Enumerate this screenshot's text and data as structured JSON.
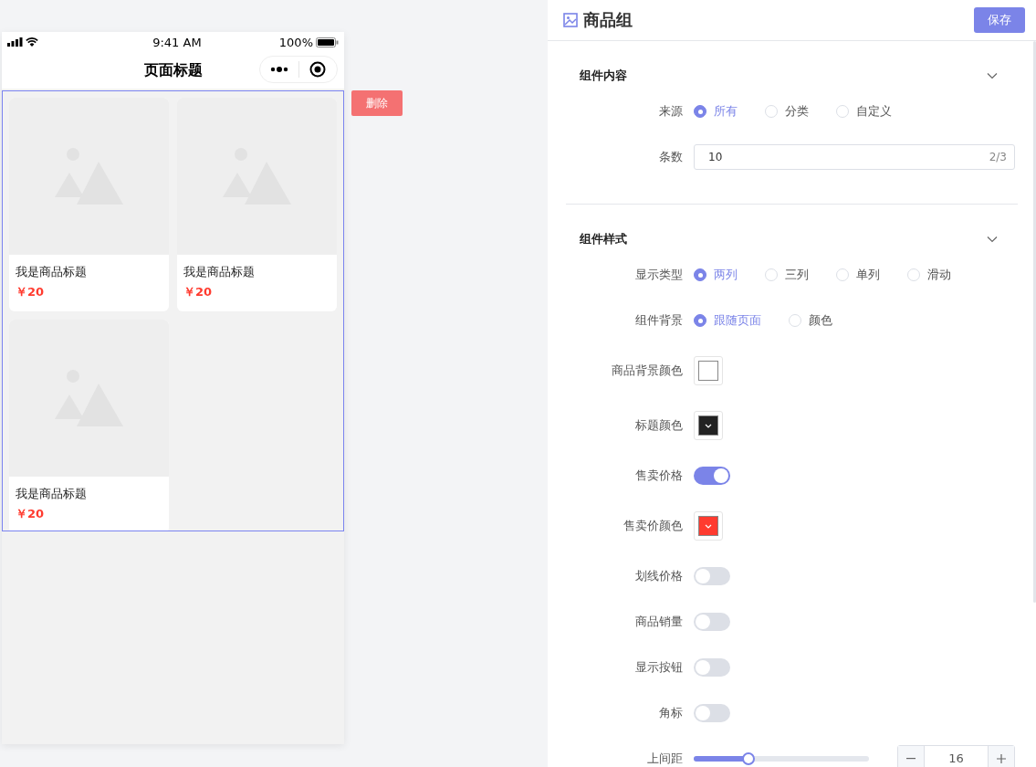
{
  "phone": {
    "status_bar": {
      "time": "9:41 AM",
      "battery": "100%"
    },
    "title": "页面标题",
    "products": [
      {
        "title": "我是商品标题",
        "price": "￥20"
      },
      {
        "title": "我是商品标题",
        "price": "￥20"
      },
      {
        "title": "我是商品标题",
        "price": "￥20"
      }
    ],
    "delete_button": "删除"
  },
  "panel": {
    "title": "商品组",
    "save_button": "保存",
    "sections": [
      {
        "title": "组件内容",
        "expanded": true,
        "fields": [
          {
            "kind": "radio",
            "label": "来源",
            "options": [
              {
                "label": "所有",
                "selected": true
              },
              {
                "label": "分类",
                "selected": false
              },
              {
                "label": "自定义",
                "selected": false
              }
            ]
          },
          {
            "kind": "input",
            "label": "条数",
            "value": "10",
            "counter": "2/3"
          }
        ]
      },
      {
        "title": "组件样式",
        "expanded": true,
        "fields": [
          {
            "kind": "radio",
            "label": "显示类型",
            "options": [
              {
                "label": "两列",
                "selected": true
              },
              {
                "label": "三列",
                "selected": false
              },
              {
                "label": "单列",
                "selected": false
              },
              {
                "label": "滑动",
                "selected": false
              }
            ]
          },
          {
            "kind": "radio",
            "label": "组件背景",
            "options": [
              {
                "label": "跟随页面",
                "selected": true
              },
              {
                "label": "颜色",
                "selected": false
              }
            ]
          },
          {
            "kind": "color",
            "label": "商品背景颜色",
            "color": "#ffffff"
          },
          {
            "kind": "color",
            "label": "标题颜色",
            "color": "#222222"
          },
          {
            "kind": "switch",
            "label": "售卖价格",
            "on": true
          },
          {
            "kind": "color",
            "label": "售卖价颜色",
            "color": "#ff3b2f"
          },
          {
            "kind": "switch",
            "label": "划线价格",
            "on": false
          },
          {
            "kind": "switch",
            "label": "商品销量",
            "on": false
          },
          {
            "kind": "switch",
            "label": "显示按钮",
            "on": false
          },
          {
            "kind": "switch",
            "label": "角标",
            "on": false
          },
          {
            "kind": "slider",
            "label": "上间距",
            "level": 0.32,
            "value": "16"
          }
        ]
      }
    ]
  }
}
